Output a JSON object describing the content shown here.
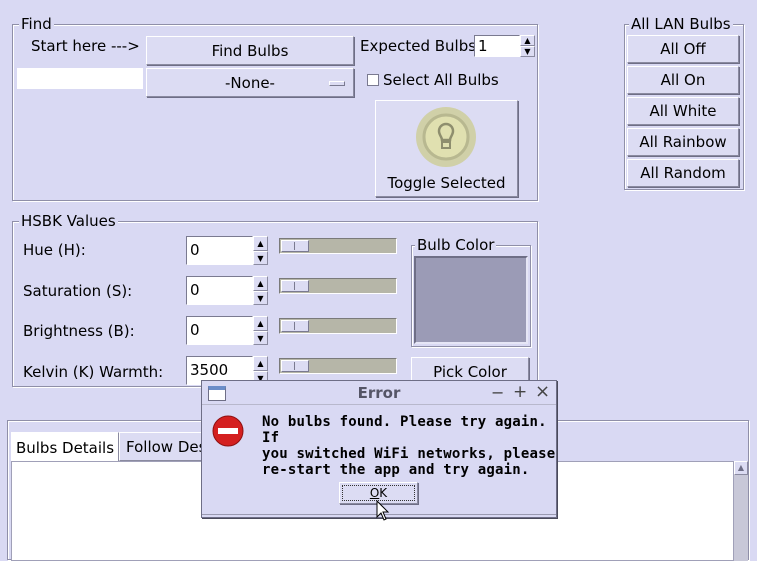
{
  "find": {
    "legend": "Find",
    "start_here": "Start here --->",
    "find_bulbs": "Find Bulbs",
    "expected_bulbs_label": "Expected Bulbs",
    "expected_bulbs_value": "1",
    "bulb_select_value": "-None-",
    "select_all_label": "Select All Bulbs",
    "toggle_selected": "Toggle Selected"
  },
  "lan": {
    "legend": "All LAN Bulbs",
    "buttons": [
      "All Off",
      "All On",
      "All White",
      "All Rainbow",
      "All Random"
    ]
  },
  "hsbk": {
    "legend": "HSBK Values",
    "rows": [
      {
        "label": "Hue (H):",
        "value": "0"
      },
      {
        "label": "Saturation (S):",
        "value": "0"
      },
      {
        "label": "Brightness (B):",
        "value": "0"
      },
      {
        "label": "Kelvin (K) Warmth:",
        "value": "3500"
      }
    ],
    "bulb_color_legend": "Bulb Color",
    "bulb_color_hex": "#9b9bb6",
    "pick_color": "Pick Color"
  },
  "tabs": {
    "items": [
      "Bulbs Details",
      "Follow Des"
    ]
  },
  "dialog": {
    "title": "Error",
    "message_line1": "No bulbs found. Please try again. If",
    "message_line2": "you switched WiFi networks, please",
    "message_line3": "re-start the app and try again.",
    "ok": "OK",
    "ok_underline": "O",
    "ok_rest": "K",
    "controls": [
      "−",
      "+",
      "×"
    ]
  }
}
